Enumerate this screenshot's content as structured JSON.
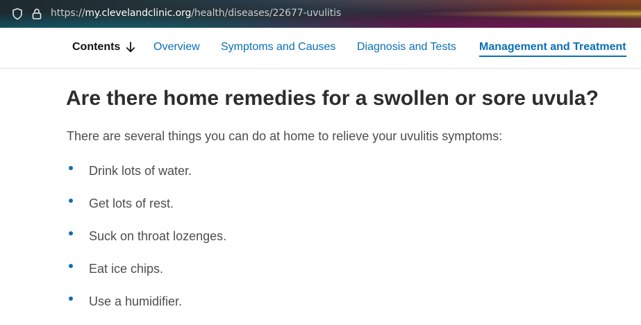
{
  "browser": {
    "url_prefix": "https://",
    "url_host": "my.clevelandclinic.org",
    "url_path": "/health/diseases/22677-uvulitis",
    "icons": [
      "shield-icon",
      "lock-icon"
    ]
  },
  "subnav": {
    "contents_label": "Contents",
    "contents_icon": "arrow-down-icon",
    "links": [
      {
        "label": "Overview",
        "active": false
      },
      {
        "label": "Symptoms and Causes",
        "active": false
      },
      {
        "label": "Diagnosis and Tests",
        "active": false
      },
      {
        "label": "Management and Treatment",
        "active": true
      }
    ]
  },
  "article": {
    "heading": "Are there home remedies for a swollen or sore uvula?",
    "intro": "There are several things you can do at home to relieve your uvulitis symptoms:",
    "remedies": [
      "Drink lots of water.",
      "Get lots of rest.",
      "Suck on throat lozenges.",
      "Eat ice chips.",
      "Use a humidifier."
    ]
  },
  "colors": {
    "link": "#0a6fb6",
    "heading": "#2d2d2d",
    "body_text": "#4d4d4d",
    "bullet": "#0a6fb6"
  }
}
